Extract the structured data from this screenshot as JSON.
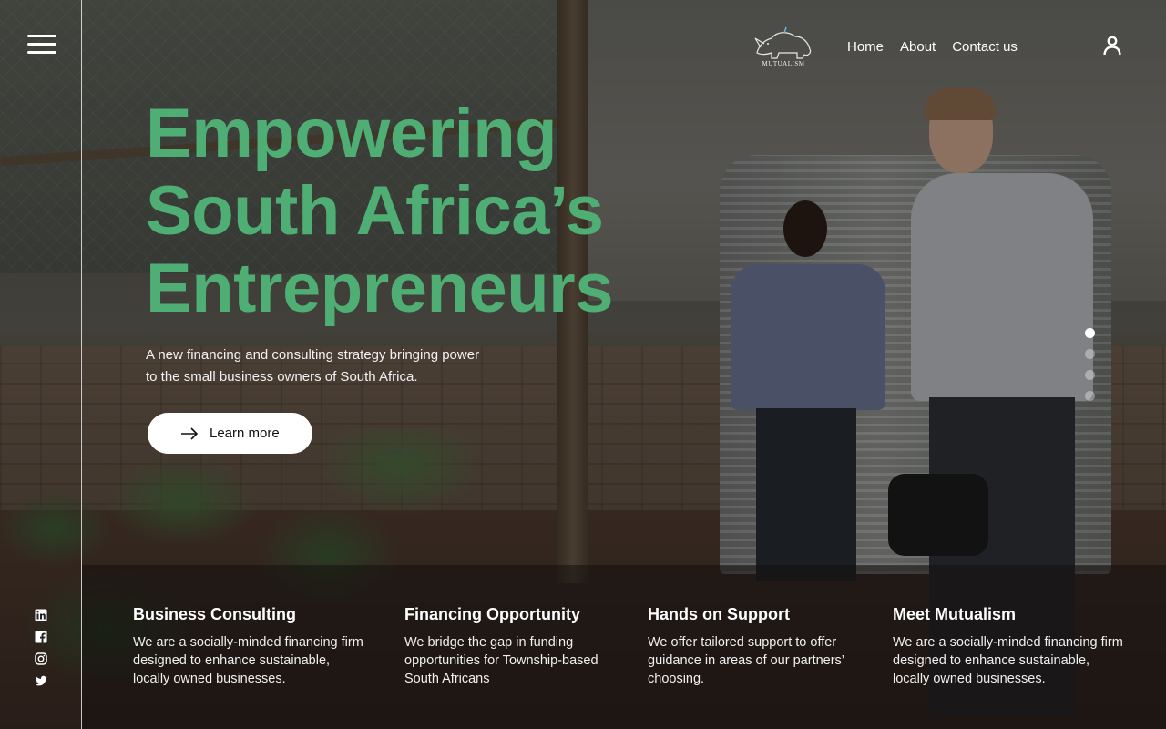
{
  "brand": {
    "logo_text": "MUTUALISM"
  },
  "nav": {
    "items": [
      {
        "label": "Home"
      },
      {
        "label": "About"
      },
      {
        "label": "Contact us"
      }
    ]
  },
  "hero": {
    "title_lines": [
      "Empowering",
      "South Africa’s",
      "Entrepreneurs"
    ],
    "subtitle": "A new financing and consulting strategy bringing power to the small business owners of South Africa.",
    "cta_label": "Learn more"
  },
  "slider": {
    "count": 4,
    "active_index": 0
  },
  "social": [
    "linkedin-icon",
    "facebook-icon",
    "instagram-icon",
    "twitter-icon"
  ],
  "features": [
    {
      "title": "Business Consulting",
      "text": "We are a socially-minded financing firm designed to enhance sustainable, locally owned businesses."
    },
    {
      "title": "Financing Opportunity",
      "text": "We bridge the gap in funding opportunities for Township-based South Africans"
    },
    {
      "title": "Hands on Support",
      "text": "We offer tailored support to offer guidance in areas of our partners’ choosing."
    },
    {
      "title": "Meet Mutualism",
      "text": "We are a socially-minded financing firm designed to enhance sustainable, locally owned businesses."
    }
  ],
  "colors": {
    "accent": "#4fae74",
    "text": "#ffffff",
    "button_bg": "#ffffff"
  }
}
